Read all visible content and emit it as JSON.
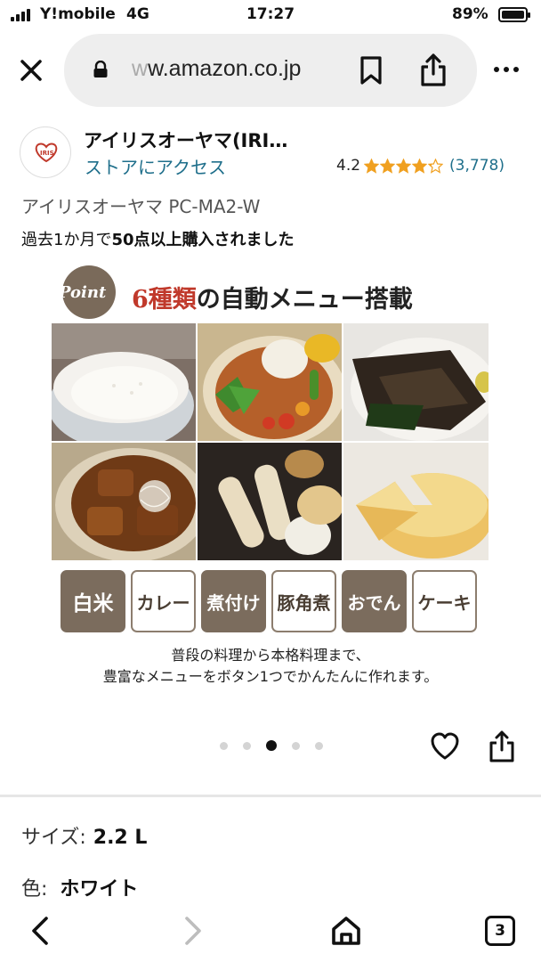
{
  "status_bar": {
    "carrier": "Y!mobile",
    "network": "4G",
    "time": "17:27",
    "battery_percent": "89%",
    "battery_level": 0.89
  },
  "browser": {
    "url_faded": "w",
    "url_main": "w.amazon.co.jp",
    "icons": [
      "close-icon",
      "lock-icon",
      "bookmark-icon",
      "share-icon",
      "more-icon"
    ]
  },
  "store": {
    "name": "アイリスオーヤマ(IRI…",
    "link_text": "ストアにアクセス",
    "rating_value": "4.2",
    "rating_stars": 4.2,
    "review_count": "(3,778)",
    "star_color": "#f0a020"
  },
  "product": {
    "model": "アイリスオーヤマ PC-MA2-W",
    "purchase_prefix": "過去1か月で",
    "purchase_bold": "50点以上購入されました"
  },
  "image": {
    "point_badge": "Point",
    "headline_red": "6種類",
    "headline_rest": "の自動メニュー搭載",
    "menu_buttons": [
      "白米",
      "カレー",
      "煮付け",
      "豚角煮",
      "おでん",
      "ケーキ"
    ],
    "caption_line1": "普段の料理から本格料理まで、",
    "caption_line2": "豊富なメニューをボタン1つでかんたんに作れます。",
    "accent_color": "#7b6c5d"
  },
  "carousel": {
    "total": 5,
    "active_index": 2
  },
  "options": {
    "size_label": "サイズ:",
    "size_value": "2.2 L",
    "color_label": "色:",
    "color_value": "ホワイト"
  },
  "toolbar": {
    "tab_count": "3"
  }
}
